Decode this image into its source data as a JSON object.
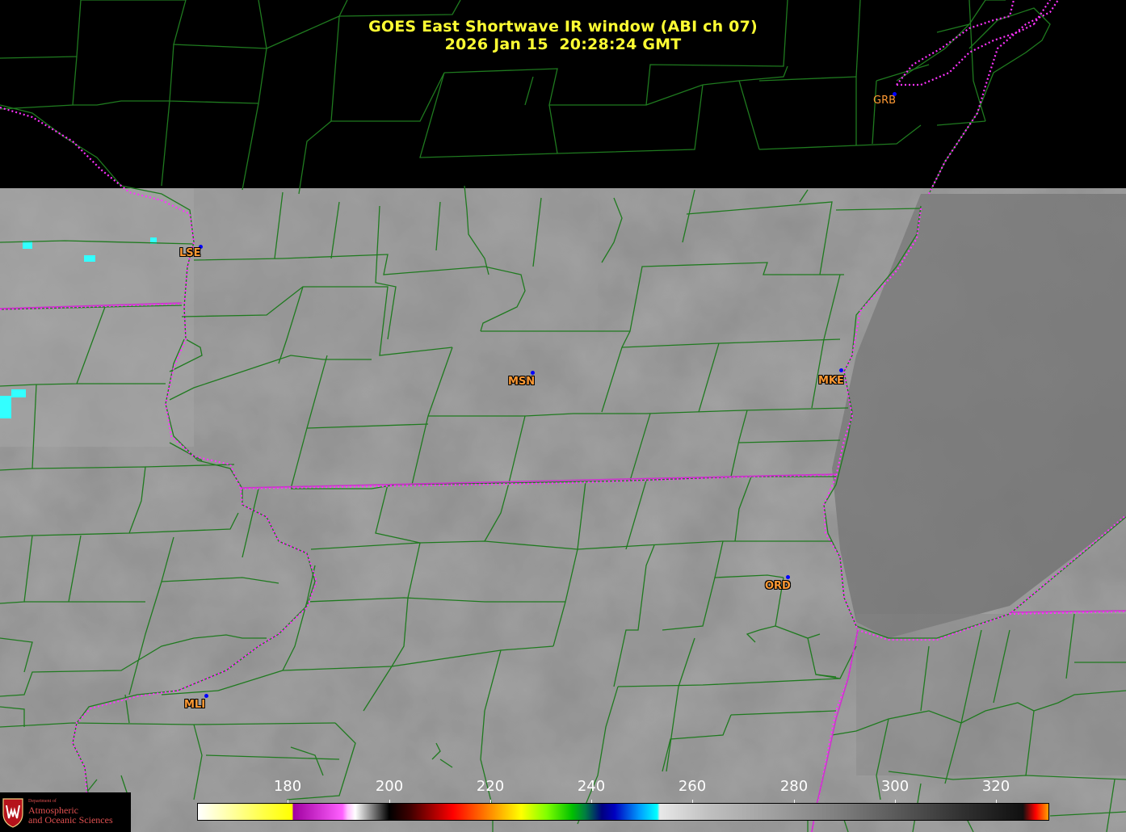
{
  "title": {
    "line1": "GOES East Shortwave IR window (ABI ch 07)",
    "line2": "2026 Jan 15  20:28:24 GMT"
  },
  "cities": [
    {
      "code": "GRB"
    },
    {
      "code": "LSE"
    },
    {
      "code": "MSN"
    },
    {
      "code": "MKE"
    },
    {
      "code": "ORD"
    },
    {
      "code": "MLI"
    }
  ],
  "colorbar": {
    "ticks": [
      "180",
      "200",
      "220",
      "240",
      "260",
      "280",
      "300",
      "320"
    ]
  },
  "logo": {
    "dept": "Department of",
    "line1": "Atmospheric",
    "line2": "and Oceanic Sciences"
  },
  "colors": {
    "title": "#ffff33",
    "county_lines": "#1f7a1f",
    "state_lines": "#ff33ff",
    "city_label": "#ff9933",
    "city_dot": "#0000ff"
  }
}
